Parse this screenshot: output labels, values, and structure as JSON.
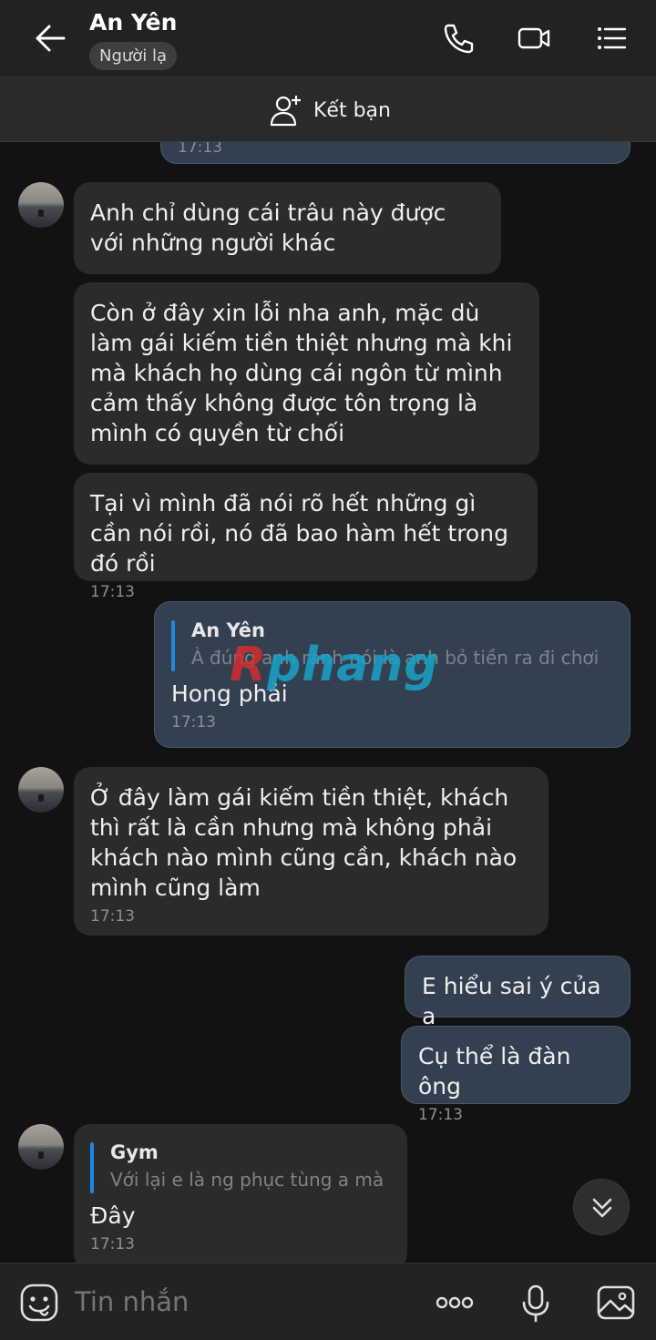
{
  "header": {
    "title": "An Yên",
    "badge": "Người lạ"
  },
  "friend_bar": {
    "label": "Kết bạn"
  },
  "messages": [
    {
      "time": "17:13"
    },
    {
      "text": "Anh chỉ dùng cái trâu này được với những người khác"
    },
    {
      "text": "Còn ở đây xin lỗi nha anh, mặc dù làm gái kiếm tiền thiệt nhưng mà khi mà khách họ dùng cái ngôn từ mình cảm thấy không được tôn trọng là mình có quyền từ chối"
    },
    {
      "text": "Tại vì mình đã nói rõ hết những gì cần nói rồi, nó đã bao hàm hết trong đó rồi",
      "time": "17:13"
    },
    {
      "quote_name": "An Yên",
      "quote_text": "À đúng anh ranh nói là anh bỏ tiền ra đi chơi",
      "text": "Hong phải",
      "time": "17:13"
    },
    {
      "text": "Ở đây làm gái kiếm tiền thiệt, khách thì rất là cần nhưng mà không phải khách nào mình cũng cần, khách nào mình cũng làm",
      "time": "17:13"
    },
    {
      "text": "E hiểu sai ý của a"
    },
    {
      "text": "Cụ thể là đàn ông",
      "time": "17:13"
    },
    {
      "quote_name": "Gym",
      "quote_text": "Với lại e là ng phục tùng a mà",
      "text": "Đây",
      "time": "17:13"
    }
  ],
  "watermark": {
    "prefix": "R",
    "rest": "phang"
  },
  "composer": {
    "placeholder": "Tin nhắn"
  }
}
